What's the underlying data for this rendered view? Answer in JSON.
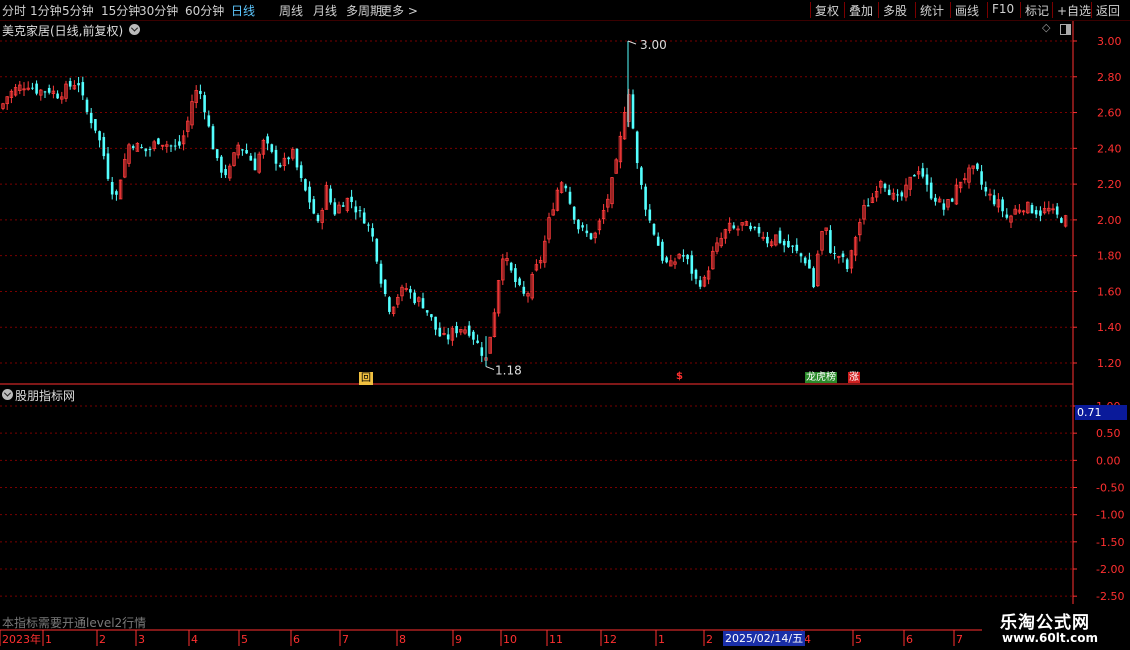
{
  "toolbar": {
    "periods": [
      "分时",
      "1分钟",
      "5分钟",
      "15分钟",
      "30分钟",
      "60分钟",
      "日线",
      "周线",
      "月线",
      "多周期",
      "更多 >"
    ],
    "active_period": "日线",
    "right_buttons": [
      "复权",
      "叠加",
      "多股",
      "统计",
      "画线",
      "F10",
      "标记",
      "+自选",
      "返回"
    ]
  },
  "stock_title": "美克家居(日线,前复权)",
  "indicator_title": "股朋指标网",
  "indicator_note": "本指标需要开通level2行情",
  "indicator_current": "0.71",
  "selected_date": "2025/02/14/五",
  "watermark": {
    "name": "乐淘公式网",
    "url": "www.60lt.com"
  },
  "markers": {
    "high_label": "3.00",
    "low_label": "1.18",
    "m1": "回",
    "m2": "$",
    "m3": "龙虎榜",
    "m4": "涨"
  },
  "colors": {
    "up": "#ff3b3b",
    "down": "#54ffff",
    "grid": "#7a0000",
    "axis": "#ff3030"
  },
  "chart_data": [
    {
      "type": "candlestick",
      "title": "美克家居(日线,前复权)",
      "y_ticks": [
        "3.00",
        "2.80",
        "2.60",
        "2.40",
        "2.20",
        "2.00",
        "1.80",
        "1.60",
        "1.40",
        "1.20"
      ],
      "ylim": [
        1.11,
        3.07
      ],
      "x_time_labels": [
        "2023年",
        "1",
        "2",
        "3",
        "4",
        "5",
        "6",
        "7",
        "8",
        "9",
        "10",
        "11",
        "12",
        "1",
        "2",
        "3",
        "4",
        "5",
        "6",
        "7"
      ],
      "max": 3.0,
      "min": 1.18,
      "close_path": [
        [
          0,
          2.62
        ],
        [
          8,
          2.7
        ],
        [
          18,
          2.74
        ],
        [
          28,
          2.76
        ],
        [
          38,
          2.72
        ],
        [
          48,
          2.73
        ],
        [
          58,
          2.7
        ],
        [
          68,
          2.74
        ],
        [
          78,
          2.78
        ],
        [
          85,
          2.62
        ],
        [
          95,
          2.52
        ],
        [
          103,
          2.38
        ],
        [
          110,
          2.2
        ],
        [
          116,
          2.12
        ],
        [
          122,
          2.28
        ],
        [
          130,
          2.44
        ],
        [
          140,
          2.4
        ],
        [
          148,
          2.38
        ],
        [
          158,
          2.45
        ],
        [
          168,
          2.42
        ],
        [
          178,
          2.4
        ],
        [
          186,
          2.5
        ],
        [
          194,
          2.72
        ],
        [
          202,
          2.7
        ],
        [
          210,
          2.48
        ],
        [
          218,
          2.3
        ],
        [
          228,
          2.25
        ],
        [
          238,
          2.42
        ],
        [
          246,
          2.38
        ],
        [
          255,
          2.3
        ],
        [
          264,
          2.44
        ],
        [
          272,
          2.36
        ],
        [
          282,
          2.3
        ],
        [
          292,
          2.38
        ],
        [
          302,
          2.2
        ],
        [
          310,
          2.1
        ],
        [
          318,
          1.97
        ],
        [
          326,
          2.18
        ],
        [
          334,
          2.04
        ],
        [
          342,
          2.1
        ],
        [
          350,
          2.12
        ],
        [
          358,
          2.04
        ],
        [
          366,
          2.0
        ],
        [
          374,
          1.88
        ],
        [
          382,
          1.64
        ],
        [
          390,
          1.5
        ],
        [
          398,
          1.58
        ],
        [
          406,
          1.62
        ],
        [
          414,
          1.56
        ],
        [
          422,
          1.54
        ],
        [
          430,
          1.46
        ],
        [
          438,
          1.36
        ],
        [
          446,
          1.33
        ],
        [
          454,
          1.38
        ],
        [
          462,
          1.4
        ],
        [
          470,
          1.38
        ],
        [
          478,
          1.3
        ],
        [
          486,
          1.22
        ],
        [
          494,
          1.48
        ],
        [
          502,
          1.82
        ],
        [
          510,
          1.72
        ],
        [
          518,
          1.62
        ],
        [
          526,
          1.56
        ],
        [
          534,
          1.7
        ],
        [
          542,
          1.8
        ],
        [
          550,
          2.02
        ],
        [
          558,
          2.18
        ],
        [
          564,
          2.24
        ],
        [
          570,
          2.1
        ],
        [
          578,
          1.96
        ],
        [
          586,
          1.92
        ],
        [
          594,
          1.9
        ],
        [
          602,
          2.02
        ],
        [
          610,
          2.16
        ],
        [
          618,
          2.35
        ],
        [
          624,
          2.6
        ],
        [
          630,
          2.85
        ],
        [
          634,
          2.4
        ],
        [
          640,
          2.22
        ],
        [
          648,
          2.02
        ],
        [
          656,
          1.9
        ],
        [
          664,
          1.76
        ],
        [
          672,
          1.74
        ],
        [
          680,
          1.82
        ],
        [
          688,
          1.76
        ],
        [
          696,
          1.66
        ],
        [
          704,
          1.65
        ],
        [
          712,
          1.8
        ],
        [
          720,
          1.88
        ],
        [
          728,
          1.96
        ],
        [
          736,
          1.94
        ],
        [
          744,
          1.98
        ],
        [
          752,
          1.92
        ],
        [
          760,
          1.94
        ],
        [
          768,
          1.88
        ],
        [
          776,
          1.91
        ],
        [
          784,
          1.86
        ],
        [
          792,
          1.84
        ],
        [
          800,
          1.8
        ],
        [
          808,
          1.76
        ],
        [
          814,
          1.62
        ],
        [
          820,
          1.92
        ],
        [
          826,
          1.94
        ],
        [
          832,
          1.8
        ],
        [
          840,
          1.8
        ],
        [
          848,
          1.72
        ],
        [
          856,
          1.92
        ],
        [
          864,
          2.06
        ],
        [
          872,
          2.12
        ],
        [
          880,
          2.24
        ],
        [
          888,
          2.18
        ],
        [
          896,
          2.1
        ],
        [
          904,
          2.14
        ],
        [
          912,
          2.24
        ],
        [
          920,
          2.3
        ],
        [
          928,
          2.16
        ],
        [
          936,
          2.12
        ],
        [
          944,
          2.06
        ],
        [
          952,
          2.12
        ],
        [
          960,
          2.22
        ],
        [
          968,
          2.26
        ],
        [
          976,
          2.28
        ],
        [
          984,
          2.16
        ],
        [
          992,
          2.12
        ],
        [
          1000,
          2.08
        ],
        [
          1008,
          2.0
        ],
        [
          1016,
          2.06
        ],
        [
          1024,
          2.08
        ],
        [
          1032,
          2.06
        ],
        [
          1040,
          2.04
        ],
        [
          1048,
          2.06
        ],
        [
          1056,
          2.02
        ],
        [
          1066,
          2.0
        ]
      ]
    },
    {
      "type": "line",
      "title": "股朋指标网",
      "y_ticks": [
        "1.00",
        "0.50",
        "0.00",
        "-0.50",
        "-1.00",
        "-1.50",
        "-2.00",
        "-2.50"
      ],
      "ylim": [
        -2.55,
        1.05
      ],
      "current_value": 0.71
    }
  ]
}
